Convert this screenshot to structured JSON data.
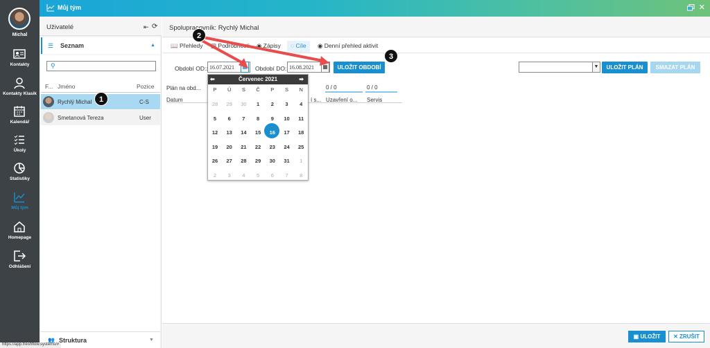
{
  "sidebar": {
    "user_name": "Michal",
    "items": [
      {
        "label": "Kontakty",
        "icon": "contact-card-icon"
      },
      {
        "label": "Kontakty Klasik",
        "icon": "person-icon"
      },
      {
        "label": "Kalendář",
        "icon": "calendar-icon"
      },
      {
        "label": "Úkoly",
        "icon": "tasks-icon"
      },
      {
        "label": "Statistiky",
        "icon": "pie-chart-icon"
      },
      {
        "label": "Můj tým",
        "icon": "trend-chart-icon",
        "active": true
      },
      {
        "label": "Homepage",
        "icon": "home-icon"
      },
      {
        "label": "Odhlášení",
        "icon": "logout-icon"
      }
    ]
  },
  "topbar": {
    "title": "Můj tým"
  },
  "users_panel": {
    "title": "Uživatelé",
    "section_list": "Seznam",
    "search_placeholder": "",
    "columns": {
      "f": "F...",
      "name": "Jméno",
      "position": "Pozice"
    },
    "rows": [
      {
        "name": "Rychlý Michal",
        "position": "C-S",
        "selected": true
      },
      {
        "name": "Smetanová Tereza",
        "position": "User",
        "selected": false
      }
    ],
    "section_structure": "Struktura"
  },
  "main": {
    "title": "Spolupracovník: Rychlý Michal",
    "tabs": [
      "Přehledy",
      "Podrobnosti",
      "Zápisy",
      "Cíle",
      "Denní přehled aktivit"
    ],
    "active_tab": "Cíle",
    "period_from_label": "Období OD::",
    "period_from_value": "16.07.2021",
    "period_to_label": "Období DO::",
    "period_to_value": "16.08.2021",
    "save_period_label": "ULOŽIT OBDOBÍ",
    "save_plan_label": "ULOŽIT PLÁN",
    "delete_plan_label": "SMAZAT PLÁN",
    "plan_select_value": "",
    "grid": {
      "plan_label": "Plán na obd...",
      "col_date": "Datum",
      "col_s": "í s...",
      "counters": [
        "0 / 0",
        "0 / 0"
      ],
      "col_closed": "Uzavření o...",
      "col_service": "Servis"
    },
    "footer_save": "ULOŽIT",
    "footer_cancel": "ZRUŠIT"
  },
  "calendar": {
    "month": "Červenec 2021",
    "weekdays": [
      "P",
      "Ú",
      "S",
      "Č",
      "P",
      "S",
      "N"
    ],
    "weeks": [
      [
        "28",
        "29",
        "30",
        "1",
        "2",
        "3",
        "4"
      ],
      [
        "5",
        "6",
        "7",
        "8",
        "9",
        "10",
        "11"
      ],
      [
        "12",
        "13",
        "14",
        "15",
        "16",
        "17",
        "18"
      ],
      [
        "19",
        "20",
        "21",
        "22",
        "23",
        "24",
        "25"
      ],
      [
        "26",
        "27",
        "28",
        "29",
        "30",
        "31",
        "1"
      ],
      [
        "2",
        "3",
        "4",
        "5",
        "6",
        "7",
        "8"
      ]
    ],
    "selected_day": "16"
  },
  "annotations": [
    "1",
    "2",
    "3"
  ],
  "status_url": "https://app.freshflow.systems/#",
  "colors": {
    "accent": "#1a8fd0",
    "sidebar_bg": "#3d4246",
    "arrow": "#e84c4c"
  }
}
